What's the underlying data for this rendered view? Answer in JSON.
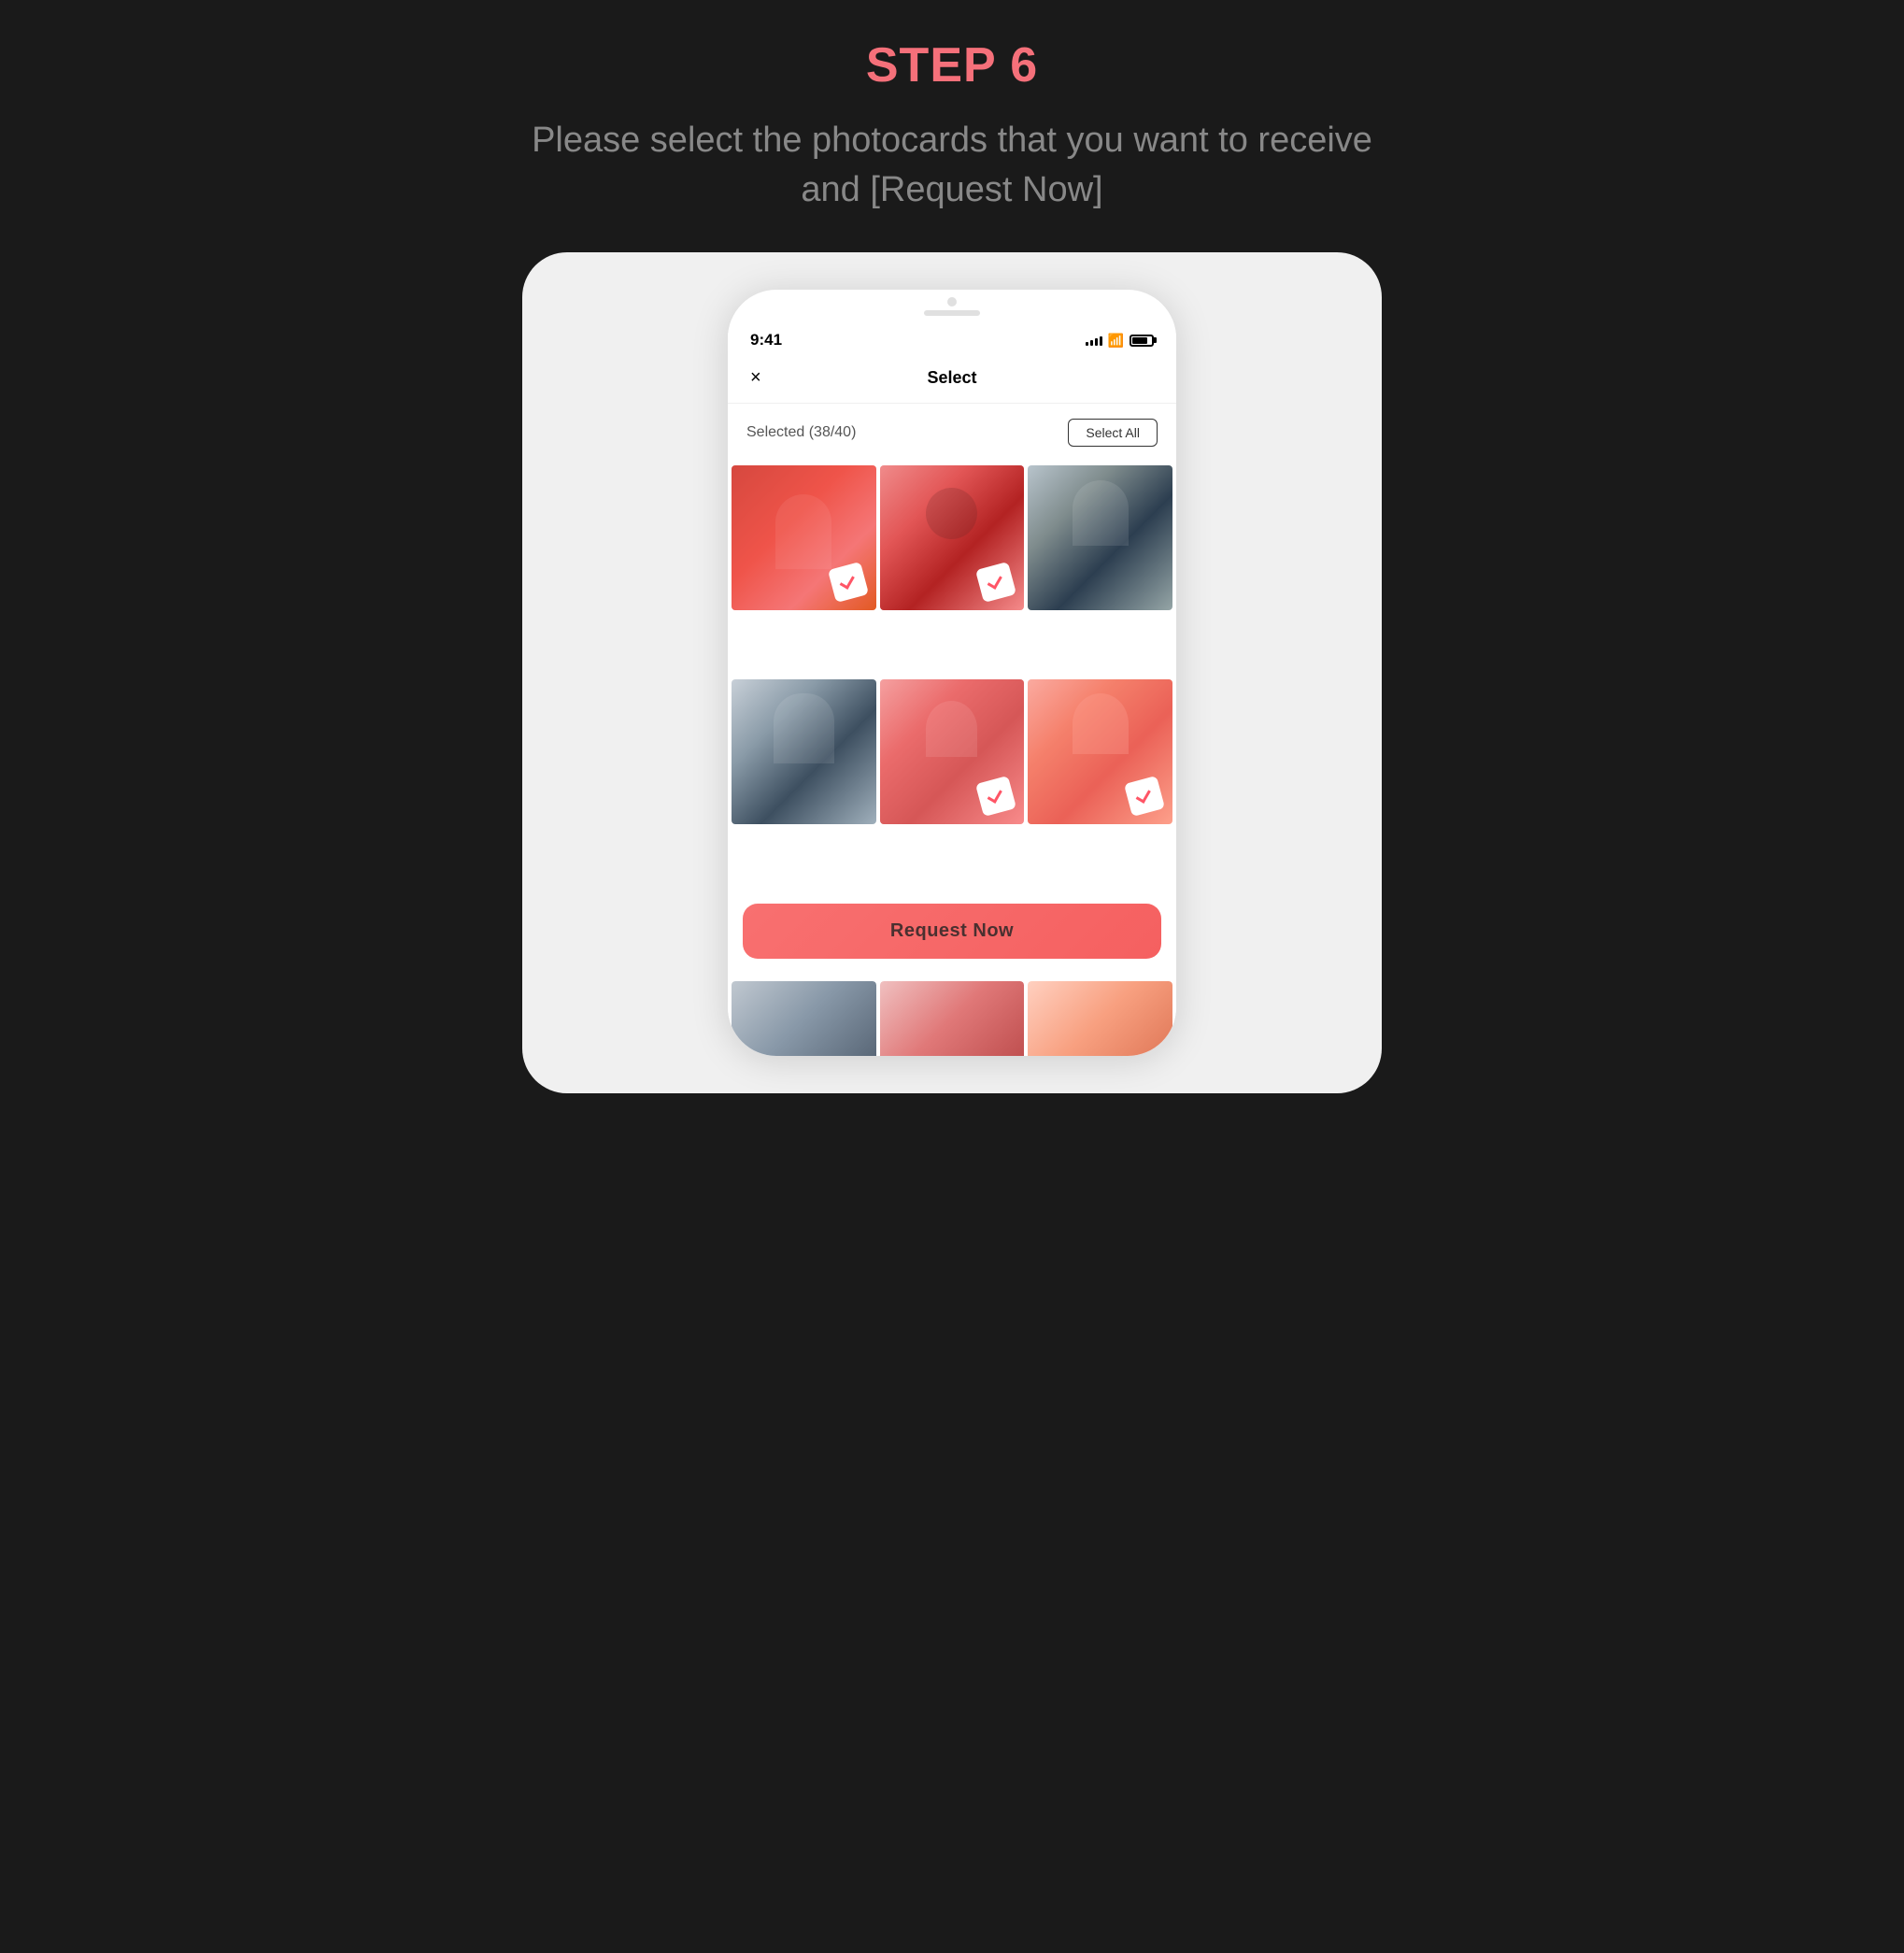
{
  "page": {
    "step_label": "STEP 6",
    "subtitle": "Please select the photocards that you want to receive and [Request Now]"
  },
  "status_bar": {
    "time": "9:41",
    "signal_label": "signal-bars",
    "wifi_label": "wifi",
    "battery_label": "battery"
  },
  "app": {
    "screen_title": "Select",
    "close_icon": "×",
    "selected_count": "Selected (38/40)",
    "select_all_btn": "Select All"
  },
  "grid": {
    "cells": [
      {
        "id": 1,
        "selected": true,
        "person_class": "person-1"
      },
      {
        "id": 2,
        "selected": true,
        "person_class": "person-2"
      },
      {
        "id": 3,
        "selected": false,
        "person_class": "person-3"
      },
      {
        "id": 4,
        "selected": false,
        "person_class": "person-4"
      },
      {
        "id": 5,
        "selected": true,
        "person_class": "person-5"
      },
      {
        "id": 6,
        "selected": true,
        "person_class": "person-6"
      }
    ],
    "bottom_cells": [
      {
        "id": 7,
        "person_class": "person-7"
      },
      {
        "id": 8,
        "person_class": "person-8"
      },
      {
        "id": 9,
        "person_class": "person-9"
      }
    ]
  },
  "request_btn": {
    "label": "Request Now"
  },
  "colors": {
    "step_color": "#f5707a",
    "subtitle_color": "#888888",
    "btn_color": "#f87070",
    "background": "#1a1a1a"
  }
}
